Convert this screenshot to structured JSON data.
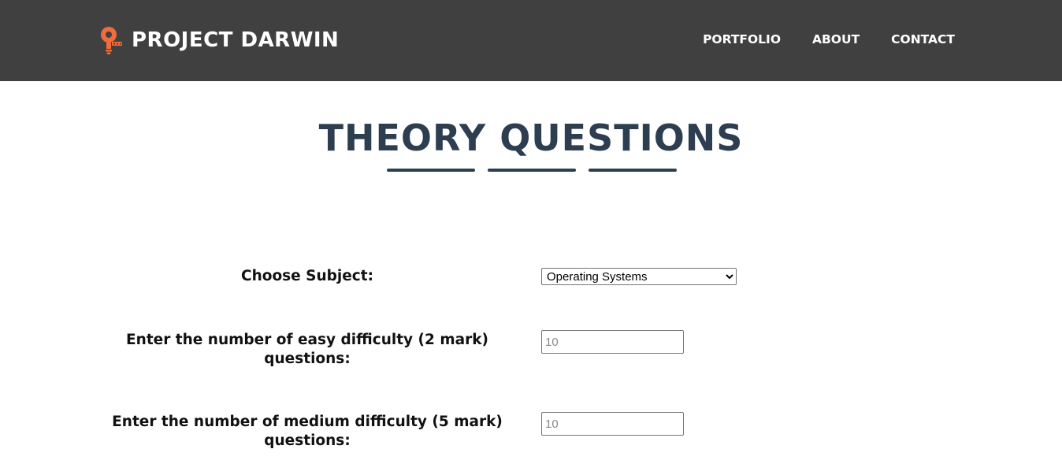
{
  "navbar": {
    "brand": "PROJECT DARWIN",
    "logo_icon": "lightbulb-gear-icon",
    "links": [
      "PORTFOLIO",
      "ABOUT",
      "CONTACT"
    ]
  },
  "page": {
    "title": "THEORY QUESTIONS"
  },
  "form": {
    "subject_label": "Choose Subject:",
    "subject_selected": "Operating Systems",
    "easy_label": "Enter the number of easy difficulty (2 mark) questions:",
    "easy_placeholder": "10",
    "medium_label": "Enter the number of medium difficulty (5 mark) questions:",
    "medium_placeholder": "10"
  },
  "colors": {
    "navbar_bg": "#404041",
    "title": "#2c3e50",
    "logo_accent": "#f26b3a"
  }
}
